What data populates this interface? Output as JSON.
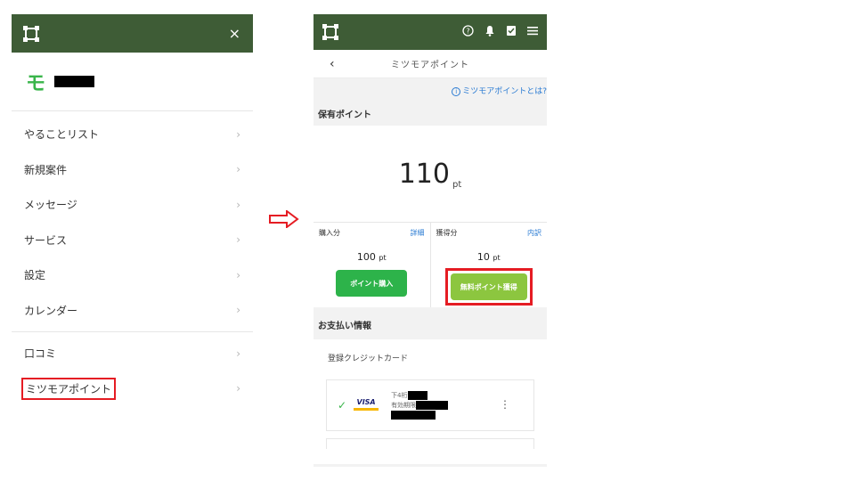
{
  "left_panel": {
    "close_label": "×",
    "user": {
      "initial": "モ"
    },
    "menu_items": [
      {
        "label": "やることリスト",
        "chevron": "›"
      },
      {
        "label": "新規案件",
        "chevron": "›"
      },
      {
        "label": "メッセージ",
        "chevron": "›"
      },
      {
        "label": "サービス",
        "chevron": "›"
      },
      {
        "label": "設定",
        "chevron": "›"
      },
      {
        "label": "カレンダー",
        "chevron": "›"
      }
    ],
    "menu_items_2": [
      {
        "label": "口コミ",
        "chevron": "›"
      },
      {
        "label": "ミツモアポイント",
        "chevron": "›"
      }
    ]
  },
  "right_panel": {
    "header_icons": [
      "help-icon",
      "bell-icon",
      "checklist-icon",
      "menu-icon"
    ],
    "back_label": "‹",
    "title": "ミツモアポイント",
    "info_icon": "i",
    "info_link": "ミツモアポイントとは?",
    "held_points_label": "保有ポイント",
    "held_points_value": "110",
    "held_points_unit": "pt",
    "purchased": {
      "label": "購入分",
      "link": "詳細",
      "amount": "100",
      "unit": "pt",
      "button": "ポイント購入"
    },
    "earned": {
      "label": "獲得分",
      "link": "内訳",
      "amount": "10",
      "unit": "pt",
      "button": "無料ポイント獲得"
    },
    "payment_label": "お支払い情報",
    "card_section_title": "登録クレジットカード",
    "card": {
      "check": "✓",
      "brand": "VISA",
      "last4_label": "下4桁",
      "expiry_label": "有効期限",
      "menu": "⋮"
    }
  },
  "colors": {
    "topbar": "#3e5c36",
    "highlight": "#e51c23",
    "buy_button": "#2db34a",
    "free_button": "#8cc63f",
    "link": "#2a7bd3"
  }
}
